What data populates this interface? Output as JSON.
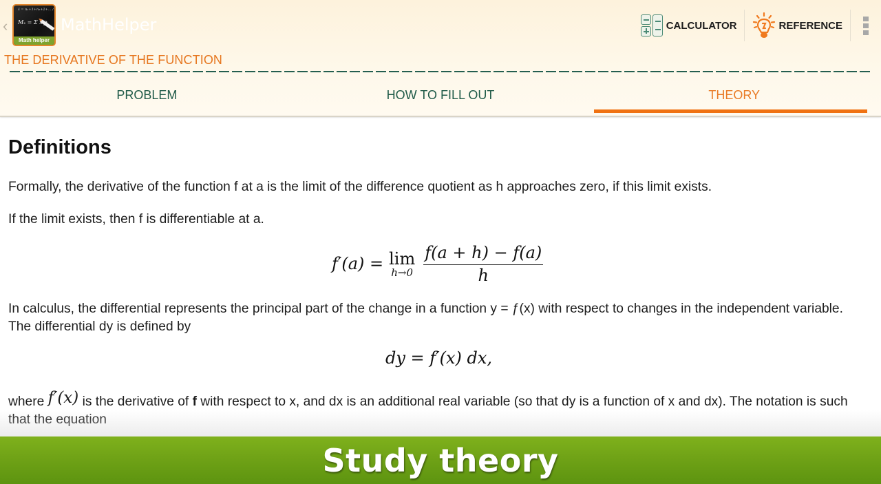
{
  "app": {
    "title": "MathHelper",
    "logo_badge": "Math helper",
    "logo_formula_top": "x̄ = n₁+1+n₂+2+... / N",
    "logo_formula_main": "Mₓ = Σ xᵢpᵢ"
  },
  "actions": {
    "calculator_label": "CALCULATOR",
    "reference_label": "REFERENCE"
  },
  "colors": {
    "accent_orange": "#f07212",
    "tab_green": "#1f5a48",
    "banner_green": "#6ea116"
  },
  "section": {
    "title": "THE DERIVATIVE OF THE FUNCTION"
  },
  "tabs": [
    {
      "label": "PROBLEM",
      "active": false
    },
    {
      "label": "HOW TO FILL OUT",
      "active": false
    },
    {
      "label": "THEORY",
      "active": true
    }
  ],
  "content": {
    "heading": "Definitions",
    "paragraphs": [
      "Formally, the derivative of the function f at a is the limit of the difference quotient as h approaches zero, if this limit exists.",
      "If the limit exists, then f is differentiable at a.",
      "In calculus, the differential represents the principal part of the change in a function y = ƒ(x) with respect to changes in the independent variable. The differential dy is defined by"
    ],
    "p4": {
      "pre": "where ",
      "math": "f′(x)",
      "mid": " is the derivative of ",
      "bold": "f",
      "post": " with respect to x, and dx is an additional real variable (so that dy is a function of x and dx). The notation is such that the equation"
    },
    "eq1": {
      "lhs": "f′(a) =",
      "lim": "lim",
      "lim_sub": "h→0",
      "numerator": "f(a + h) − f(a)",
      "denominator": "h"
    },
    "eq2": "dy = f′(x) dx,"
  },
  "banner": {
    "text": "Study theory"
  }
}
